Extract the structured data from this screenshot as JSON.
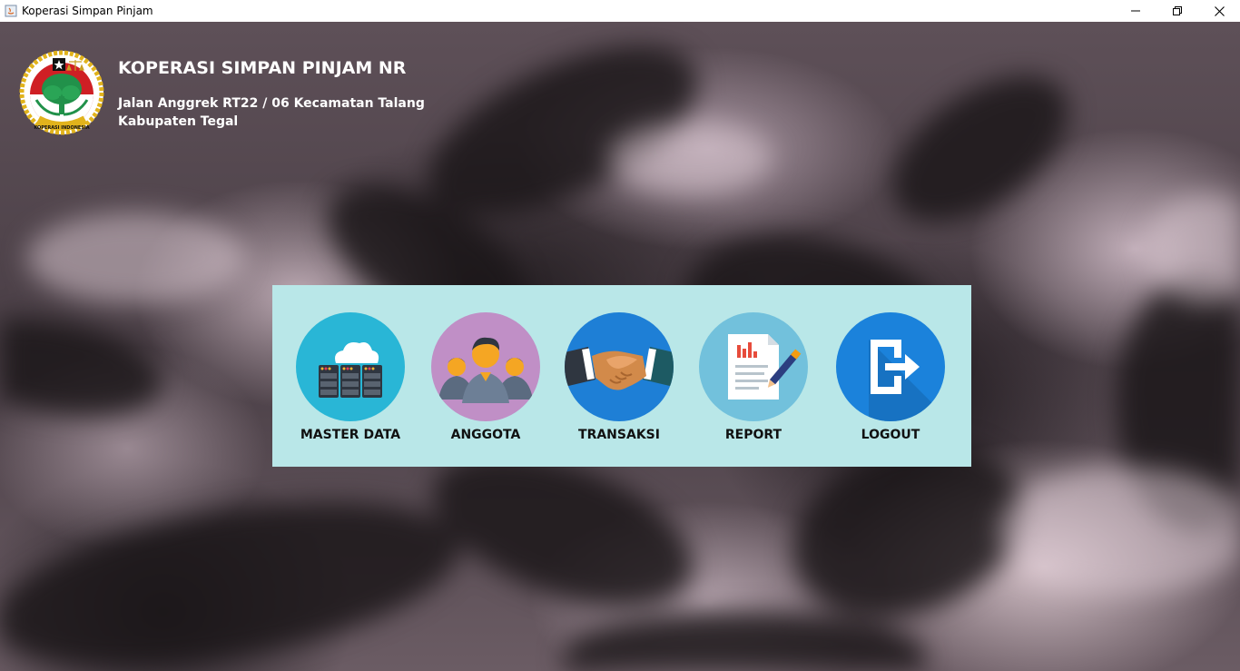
{
  "window": {
    "title": "Koperasi Simpan Pinjam",
    "controls": [
      "minimize-icon",
      "restore-icon",
      "close-icon"
    ]
  },
  "header": {
    "logo_text": "KOPERASI INDONESIA",
    "name": "KOPERASI SIMPAN PINJAM NR",
    "address_line1": "Jalan Anggrek RT22 / 06 Kecamatan Talang",
    "address_line2": "Kabupaten Tegal"
  },
  "menu": {
    "panel_color": "#b9e7e8",
    "items": [
      {
        "label": "MASTER DATA",
        "icon": "server-cloud-icon",
        "color": "#29b6d6"
      },
      {
        "label": "ANGGOTA",
        "icon": "people-group-icon",
        "color": "#c08fc6"
      },
      {
        "label": "TRANSAKSI",
        "icon": "handshake-icon",
        "color": "#1e7fd6"
      },
      {
        "label": "REPORT",
        "icon": "report-document-icon",
        "color": "#72c1dc"
      },
      {
        "label": "LOGOUT",
        "icon": "logout-exit-icon",
        "color": "#1b82db"
      }
    ]
  }
}
